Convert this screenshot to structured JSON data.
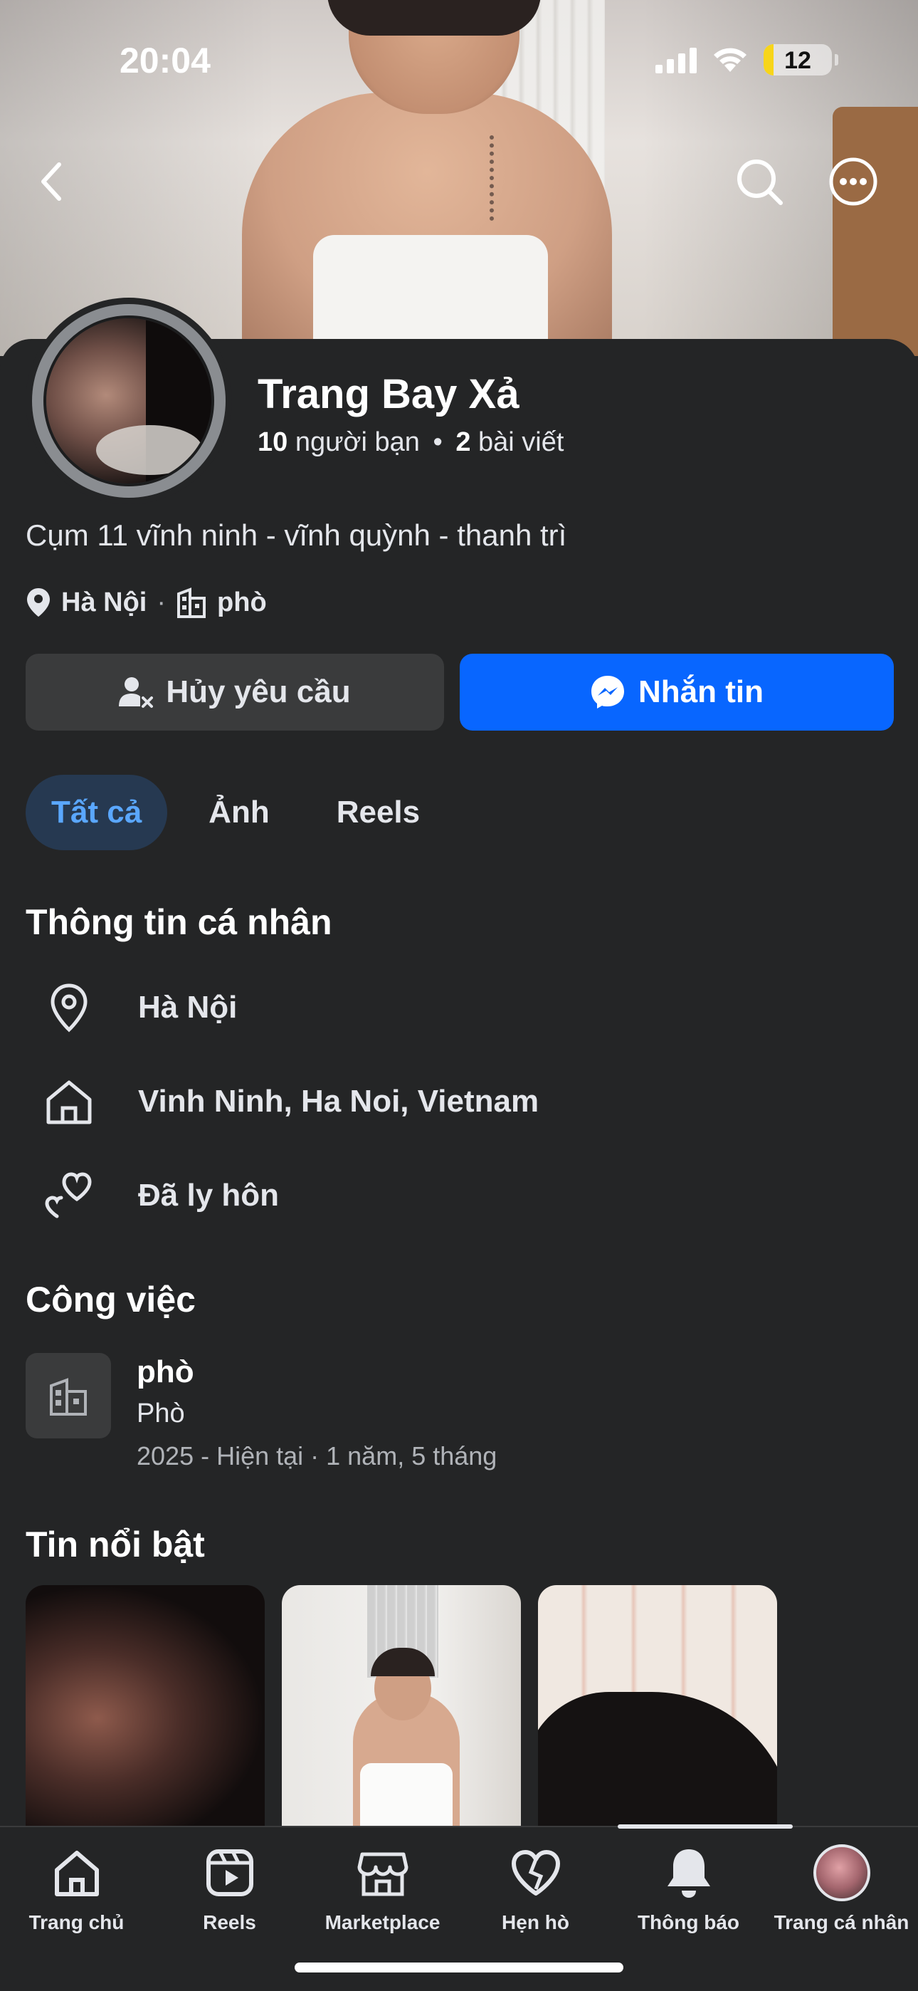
{
  "status_bar": {
    "time": "20:04",
    "battery": "12"
  },
  "profile": {
    "name": "Trang Bay Xả",
    "friends_count": "10",
    "friends_label": "người bạn",
    "separator": "•",
    "posts_count": "2",
    "posts_label": "bài viết",
    "bio": "Cụm 11 vĩnh ninh - vĩnh quỳnh - thanh trì",
    "location": "Hà Nội",
    "meta_separator": "·",
    "workplace": "phò"
  },
  "actions": {
    "cancel_request": "Hủy yêu cầu",
    "message": "Nhắn tin"
  },
  "tabs": [
    {
      "label": "Tất cả",
      "active": true
    },
    {
      "label": "Ảnh",
      "active": false
    },
    {
      "label": "Reels",
      "active": false
    }
  ],
  "personal_info": {
    "title": "Thông tin cá nhân",
    "items": [
      {
        "icon": "location-pin-icon",
        "text": "Hà Nội"
      },
      {
        "icon": "home-icon",
        "text": "Vinh Ninh, Ha Noi, Vietnam"
      },
      {
        "icon": "hearts-icon",
        "text": "Đã ly hôn"
      }
    ]
  },
  "work": {
    "title": "Công việc",
    "position": "phò",
    "company": "Phò",
    "dates": "2025 - Hiện tại · 1 năm, 5 tháng"
  },
  "highlights": {
    "title": "Tin nổi bật"
  },
  "nav": [
    {
      "label": "Trang chủ",
      "icon": "home-icon"
    },
    {
      "label": "Reels",
      "icon": "reels-icon"
    },
    {
      "label": "Marketplace",
      "icon": "marketplace-icon"
    },
    {
      "label": "Hẹn hò",
      "icon": "dating-heart-icon"
    },
    {
      "label": "Thông báo",
      "icon": "bell-icon",
      "active": true
    },
    {
      "label": "Trang cá nhân",
      "icon": "profile-avatar"
    }
  ],
  "colors": {
    "accent": "#0866ff",
    "background": "#242526",
    "active_tab_bg": "#263951",
    "active_tab_text": "#5aa7ff"
  }
}
